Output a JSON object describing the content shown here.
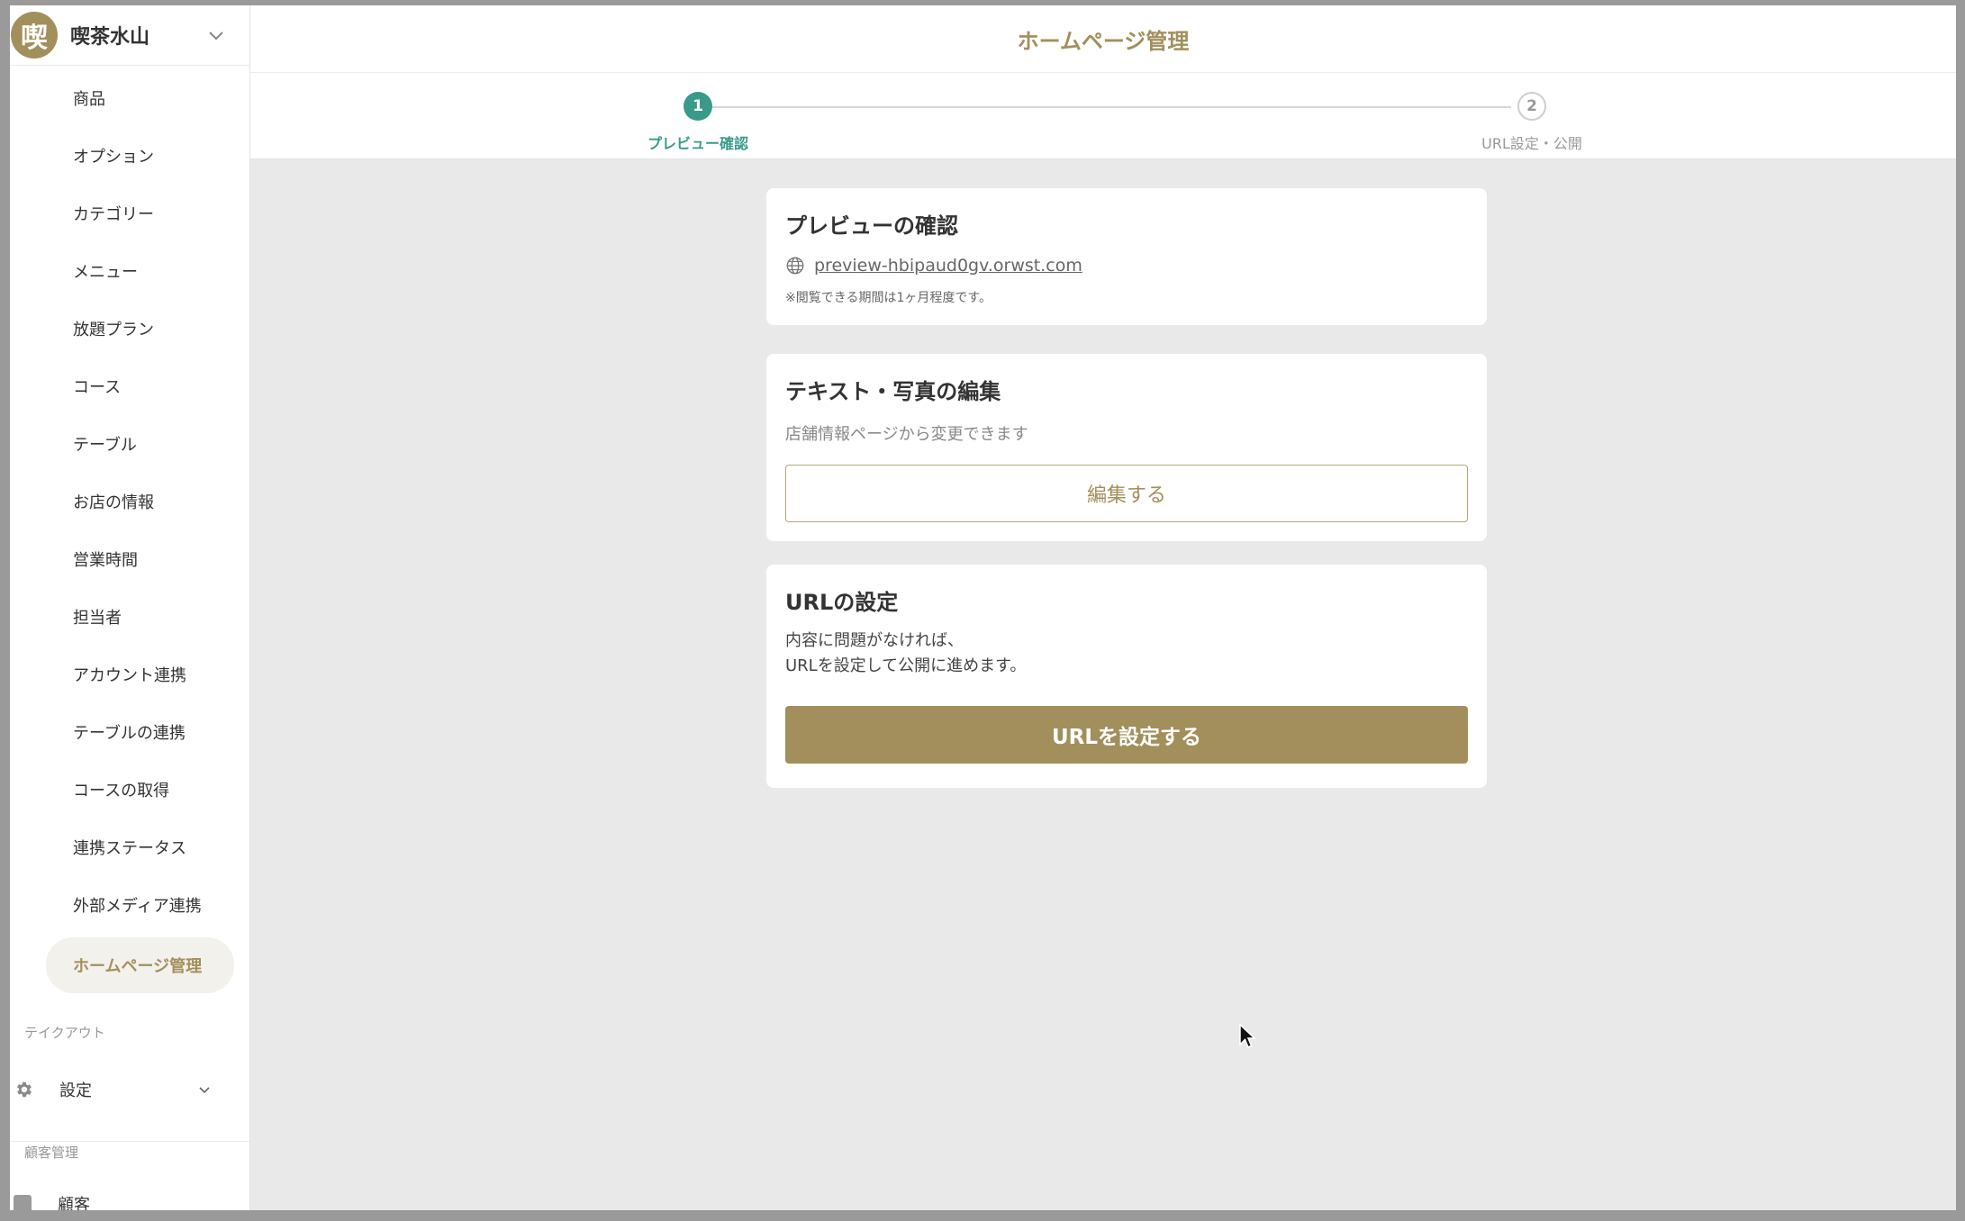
{
  "sidebar": {
    "store_initial": "喫",
    "store_name": "喫茶水山",
    "items": [
      {
        "label": "商品"
      },
      {
        "label": "オプション"
      },
      {
        "label": "カテゴリー"
      },
      {
        "label": "メニュー"
      },
      {
        "label": "放題プラン"
      },
      {
        "label": "コース"
      },
      {
        "label": "テーブル"
      },
      {
        "label": "お店の情報"
      },
      {
        "label": "営業時間"
      },
      {
        "label": "担当者"
      },
      {
        "label": "アカウント連携"
      },
      {
        "label": "テーブルの連携"
      },
      {
        "label": "コースの取得"
      },
      {
        "label": "連携ステータス"
      },
      {
        "label": "外部メディア連携"
      },
      {
        "label": "ホームページ管理"
      }
    ],
    "takeout_label": "テイクアウト",
    "settings_label": "設定",
    "customer_section_label": "顧客管理",
    "customer_label": "顧客"
  },
  "header": {
    "title": "ホームページ管理"
  },
  "stepper": {
    "steps": [
      {
        "number": "1",
        "label": "プレビュー確認"
      },
      {
        "number": "2",
        "label": "URL設定・公開"
      }
    ]
  },
  "preview_card": {
    "title": "プレビューの確認",
    "url": "preview-hbipaud0gv.orwst.com",
    "note": "※閲覧できる期間は1ヶ月程度です。"
  },
  "edit_card": {
    "title": "テキスト・写真の編集",
    "subtitle": "店舗情報ページから変更できます",
    "button_label": "編集する"
  },
  "url_card": {
    "title": "URLの設定",
    "desc_line1": "内容に問題がなければ、",
    "desc_line2": "URLを設定して公開に進めます。",
    "button_label": "URLを設定する"
  },
  "colors": {
    "accent": "#a38f5c",
    "step_active": "#3a9a8a"
  }
}
